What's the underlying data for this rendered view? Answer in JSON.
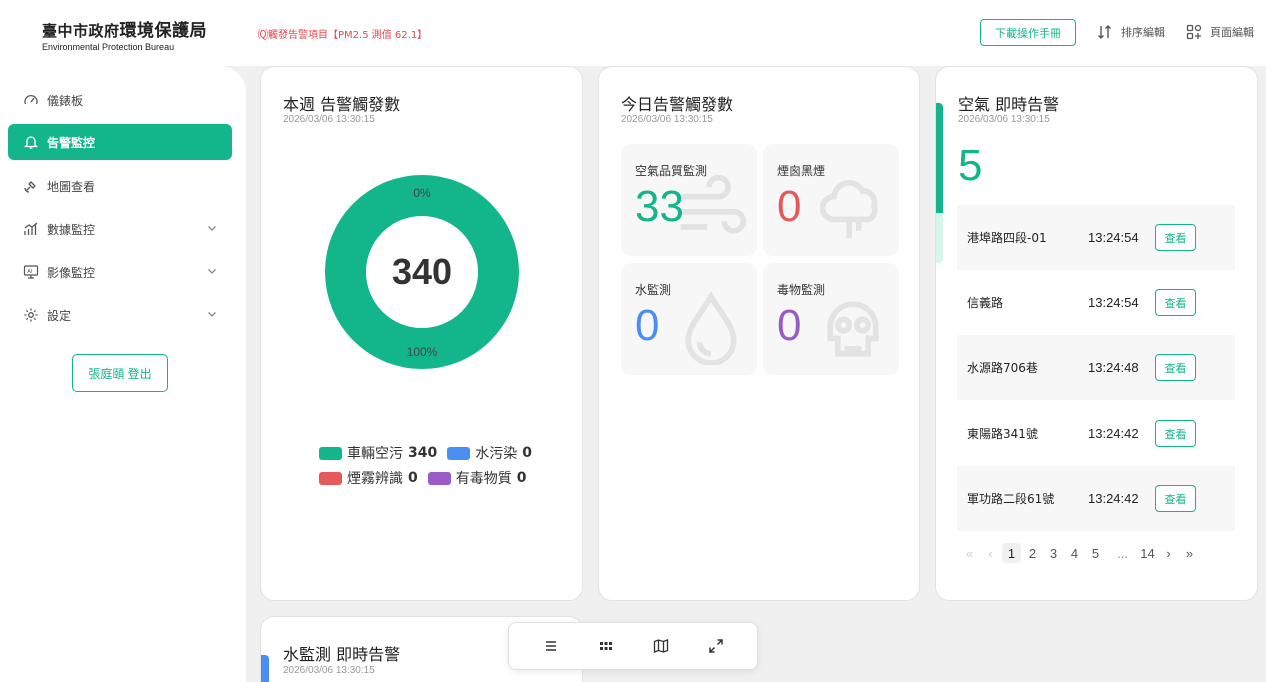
{
  "header": {
    "logo_zh_small": "臺中市政府",
    "logo_zh_big": "環境保護局",
    "logo_en": "Environmental Protection Bureau",
    "marquee": "🄠觸發告警項目【PM2.5 測值 62.1】",
    "manual_button": "下載操作手冊",
    "sort_edit": "排序編輯",
    "page_edit": "頁面編輯"
  },
  "sidebar": {
    "items": [
      {
        "label": "儀錶板",
        "icon": "gauge-icon"
      },
      {
        "label": "告警監控",
        "icon": "bell-icon"
      },
      {
        "label": "地圖查看",
        "icon": "satellite-icon"
      },
      {
        "label": "數據監控",
        "icon": "bar-chart-icon"
      },
      {
        "label": "影像監控",
        "icon": "ai-monitor-icon"
      },
      {
        "label": "設定",
        "icon": "gear-icon"
      }
    ],
    "logout": "張庭頤 登出"
  },
  "weekly": {
    "title": "本週 告警觸發數",
    "time": "2026/03/06 13:30:15"
  },
  "chart_data": {
    "type": "pie",
    "categories": [
      "車輛空污",
      "水污染",
      "煙霧辨識",
      "有毒物質"
    ],
    "values": [
      340,
      0,
      0,
      0
    ],
    "total": "340",
    "top_label": "0%",
    "bottom_label": "100%",
    "colors": [
      "#13b58b",
      "#4b8ef2",
      "#e5595b",
      "#9a5cc4"
    ]
  },
  "today": {
    "title": "今日告警觸發數",
    "time": "2026/03/06 13:30:15",
    "tiles": [
      {
        "label": "空氣品質監測",
        "value": "33",
        "color": "#13b58b",
        "icon": "wind-icon"
      },
      {
        "label": "煙囪黑煙",
        "value": "0",
        "color": "#e5595b",
        "icon": "smoke-cloud-icon"
      },
      {
        "label": "水監測",
        "value": "0",
        "color": "#4b8ef2",
        "icon": "water-drop-icon"
      },
      {
        "label": "毒物監測",
        "value": "0",
        "color": "#9a5cc4",
        "icon": "skull-icon"
      }
    ]
  },
  "air_alerts": {
    "title": "空氣 即時告警",
    "time": "2026/03/06 13:30:15",
    "count": "5",
    "rows": [
      {
        "location": "港埠路四段-01",
        "time": "13:24:54",
        "action": "查看"
      },
      {
        "location": "信義路",
        "time": "13:24:54",
        "action": "查看"
      },
      {
        "location": "水源路706巷",
        "time": "13:24:48",
        "action": "查看"
      },
      {
        "location": "東陽路341號",
        "time": "13:24:42",
        "action": "查看"
      },
      {
        "location": "軍功路二段61號",
        "time": "13:24:42",
        "action": "查看"
      }
    ],
    "pager": [
      "1",
      "2",
      "3",
      "4",
      "5",
      "...",
      "14"
    ],
    "current_page": "1"
  },
  "water_alerts": {
    "title": "水監測 即時告警",
    "time": "2026/03/06 13:30:15"
  },
  "dock": [
    "list-icon",
    "grid-icon",
    "map-icon",
    "expand-icon"
  ]
}
